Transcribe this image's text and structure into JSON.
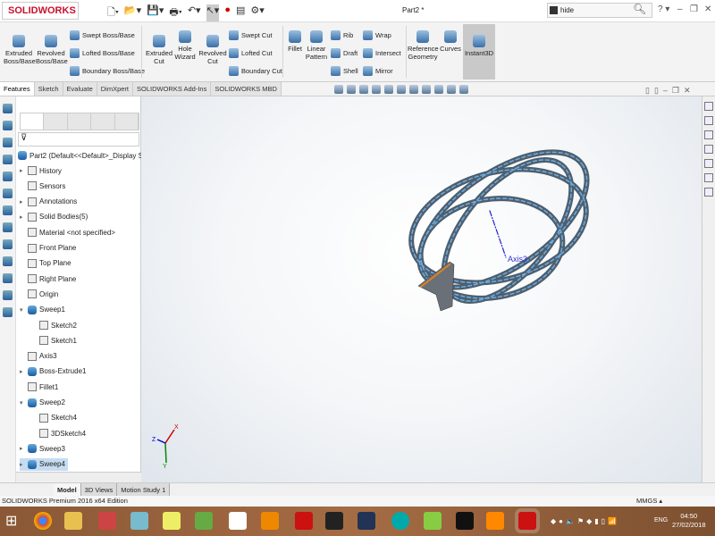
{
  "app": {
    "logo": "SOLIDWORKS",
    "doc_title": "Part2 *",
    "search_value": "hide"
  },
  "colors": {
    "accent": "#c8102e",
    "selection": "#c5dcf2",
    "tube": "#5b6b78",
    "tube_stripe": "#5aa0e0",
    "axis": "#2020d0",
    "edge_highlight": "#e08020"
  },
  "ribbon": {
    "big": [
      {
        "id": "extruded-boss",
        "label": "Extruded\nBoss/Base"
      },
      {
        "id": "revolved-boss",
        "label": "Revolved\nBoss/Base"
      },
      {
        "id": "extruded-cut",
        "label": "Extruded\nCut"
      },
      {
        "id": "hole-wizard",
        "label": "Hole\nWizard"
      },
      {
        "id": "revolved-cut",
        "label": "Revolved\nCut"
      },
      {
        "id": "fillet",
        "label": "Fillet"
      },
      {
        "id": "linear-pattern",
        "label": "Linear\nPattern"
      },
      {
        "id": "reference-geometry",
        "label": "Reference\nGeometry"
      },
      {
        "id": "curves",
        "label": "Curves"
      },
      {
        "id": "instant3d",
        "label": "Instant3D"
      }
    ],
    "small": [
      "Swept Boss/Base",
      "Lofted Boss/Base",
      "Boundary Boss/Base",
      "Swept Cut",
      "Lofted Cut",
      "Boundary Cut",
      "Rib",
      "Draft",
      "Shell",
      "Wrap",
      "Intersect",
      "Mirror"
    ]
  },
  "tabs": [
    "Features",
    "Sketch",
    "Evaluate",
    "DimXpert",
    "SOLIDWORKS Add-Ins",
    "SOLIDWORKS MBD"
  ],
  "tree": {
    "root": "Part2  (Default<<Default>_Display State",
    "items": [
      {
        "label": "History",
        "exp": "▸",
        "indent": 0
      },
      {
        "label": "Sensors",
        "exp": "",
        "indent": 0
      },
      {
        "label": "Annotations",
        "exp": "▸",
        "indent": 0
      },
      {
        "label": "Solid Bodies(5)",
        "exp": "▸",
        "indent": 0
      },
      {
        "label": "Material <not specified>",
        "exp": "",
        "indent": 0
      },
      {
        "label": "Front Plane",
        "exp": "",
        "indent": 0
      },
      {
        "label": "Top Plane",
        "exp": "",
        "indent": 0
      },
      {
        "label": "Right Plane",
        "exp": "",
        "indent": 0
      },
      {
        "label": "Origin",
        "exp": "",
        "indent": 0
      },
      {
        "label": "Sweep1",
        "exp": "▾",
        "indent": 0,
        "blue": true
      },
      {
        "label": "Sketch2",
        "exp": "",
        "indent": 1
      },
      {
        "label": "Sketch1",
        "exp": "",
        "indent": 1
      },
      {
        "label": "Axis3",
        "exp": "",
        "indent": 0
      },
      {
        "label": "Boss-Extrude1",
        "exp": "▸",
        "indent": 0,
        "blue": true
      },
      {
        "label": "Fillet1",
        "exp": "",
        "indent": 0
      },
      {
        "label": "Sweep2",
        "exp": "▾",
        "indent": 0,
        "blue": true
      },
      {
        "label": "Sketch4",
        "exp": "",
        "indent": 1
      },
      {
        "label": "3DSketch4",
        "exp": "",
        "indent": 1
      },
      {
        "label": "Sweep3",
        "exp": "▸",
        "indent": 0,
        "blue": true
      },
      {
        "label": "Sweep4",
        "exp": "▸",
        "indent": 0,
        "blue": true,
        "selected": true
      }
    ]
  },
  "viewport": {
    "axis_label": "Axis3",
    "triad": {
      "x": "X",
      "y": "Y",
      "z": "Z"
    }
  },
  "bottom_tabs": [
    "Model",
    "3D Views",
    "Motion Study 1"
  ],
  "status": {
    "text": "SOLIDWORKS Premium 2016 x64 Edition",
    "units": "MMGS"
  },
  "taskbar": {
    "lang": "ENG",
    "time": "04:50",
    "date": "27/02/2018"
  }
}
